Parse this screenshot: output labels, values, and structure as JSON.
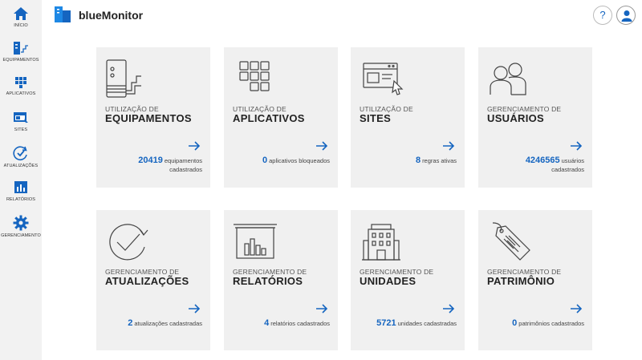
{
  "app": {
    "title": "blueMonitor",
    "help_label": "?"
  },
  "colors": {
    "accent": "#1565c0",
    "sidebar_bg": "#f2f2f2",
    "card_bg": "#f0f0f0"
  },
  "sidebar": {
    "items": [
      {
        "label": "INÍCIO",
        "icon": "home-icon"
      },
      {
        "label": "EQUIPAMENTOS",
        "icon": "equipment-icon"
      },
      {
        "label": "APLICATIVOS",
        "icon": "apps-grid-icon"
      },
      {
        "label": "SITES",
        "icon": "browser-window-icon"
      },
      {
        "label": "ATUALIZAÇÕES",
        "icon": "refresh-check-icon"
      },
      {
        "label": "RELATÓRIOS",
        "icon": "bar-chart-icon"
      },
      {
        "label": "GERENCIAMENTO",
        "icon": "gear-icon"
      }
    ]
  },
  "cards": [
    {
      "subtitle": "UTILIZAÇÃO DE",
      "title": "EQUIPAMENTOS",
      "count": "20419",
      "desc_lines": [
        "equipamentos",
        "cadastrados"
      ],
      "icon": "server-icon"
    },
    {
      "subtitle": "UTILIZAÇÃO DE",
      "title": "APLICATIVOS",
      "count": "0",
      "desc_lines": [
        "aplicativos bloqueados"
      ],
      "icon": "apps-grid-icon"
    },
    {
      "subtitle": "UTILIZAÇÃO DE",
      "title": "SITES",
      "count": "8",
      "desc_lines": [
        "regras ativas"
      ],
      "icon": "browser-cursor-icon"
    },
    {
      "subtitle": "GERENCIAMENTO DE",
      "title": "USUÁRIOS",
      "count": "4246565",
      "desc_lines": [
        "usuários",
        "cadastrados"
      ],
      "icon": "users-icon"
    },
    {
      "subtitle": "GERENCIAMENTO DE",
      "title": "ATUALIZAÇÕES",
      "count": "2",
      "desc_lines": [
        "atualizações cadastradas"
      ],
      "icon": "refresh-check-icon"
    },
    {
      "subtitle": "GERENCIAMENTO DE",
      "title": "RELATÓRIOS",
      "count": "4",
      "desc_lines": [
        "relatórios cadastrados"
      ],
      "icon": "report-chart-icon"
    },
    {
      "subtitle": "GERENCIAMENTO DE",
      "title": "UNIDADES",
      "count": "5721",
      "desc_lines": [
        "unidades cadastradas"
      ],
      "icon": "building-icon"
    },
    {
      "subtitle": "GERENCIAMENTO DE",
      "title": "PATRIMÔNIO",
      "count": "0",
      "desc_lines": [
        "patrimônios cadastrados"
      ],
      "icon": "tag-icon"
    }
  ]
}
